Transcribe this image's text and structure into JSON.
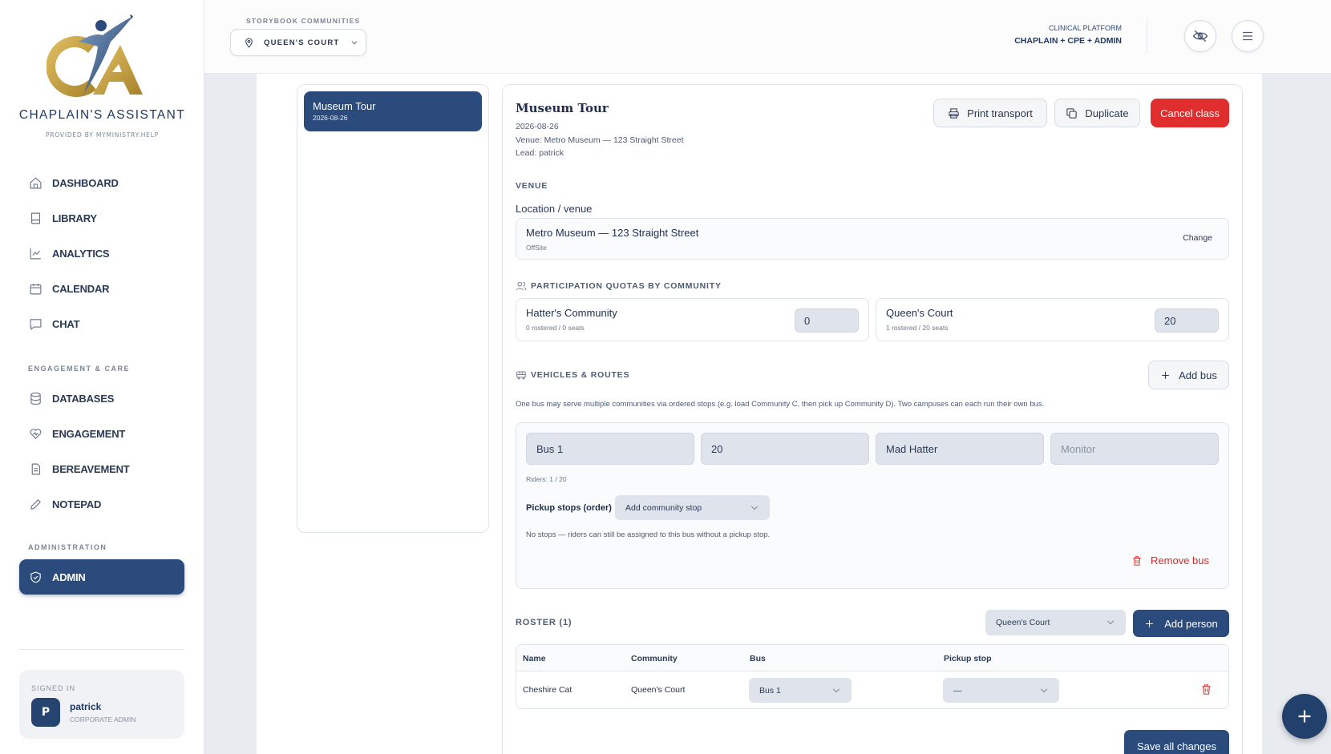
{
  "brand": {
    "name": "CHAPLAIN'S ASSISTANT",
    "sub": "PROVIDED BY MYMINISTRY.HELP",
    "logo_letters": "CA"
  },
  "nav": {
    "main": [
      {
        "label": "DASHBOARD",
        "icon": "home-icon"
      },
      {
        "label": "LIBRARY",
        "icon": "book-icon"
      },
      {
        "label": "ANALYTICS",
        "icon": "chart-icon"
      },
      {
        "label": "CALENDAR",
        "icon": "calendar-icon"
      },
      {
        "label": "CHAT",
        "icon": "chat-icon"
      }
    ],
    "section_engagement": "ENGAGEMENT & CARE",
    "engagement": [
      {
        "label": "DATABASES",
        "icon": "database-icon"
      },
      {
        "label": "ENGAGEMENT",
        "icon": "heart-icon"
      },
      {
        "label": "BEREAVEMENT",
        "icon": "document-icon"
      },
      {
        "label": "NOTEPAD",
        "icon": "pen-icon"
      }
    ],
    "section_admin": "ADMINISTRATION",
    "admin": [
      {
        "label": "ADMIN",
        "icon": "shield-icon",
        "active": true
      }
    ]
  },
  "user": {
    "signed_in_label": "SIGNED IN",
    "initial": "P",
    "name": "patrick",
    "role": "CORPORATE ADMIN"
  },
  "topbar": {
    "community_label": "STORYBOOK COMMUNITIES",
    "community_value": "QUEEN'S COURT",
    "platform_label": "CLINICAL PLATFORM",
    "platform_value": "CHAPLAIN + CPE + ADMIN"
  },
  "class_list": [
    {
      "name": "Museum Tour",
      "date": "2026-08-26",
      "selected": true
    }
  ],
  "detail": {
    "title": "Museum Tour",
    "date": "2026-08-26",
    "venue_line": "Venue: Metro Museum — 123 Straight Street",
    "lead_line": "Lead: patrick",
    "buttons": {
      "print": "Print transport",
      "duplicate": "Duplicate",
      "cancel": "Cancel class"
    },
    "venue_section": "VENUE",
    "location_label": "Location / venue",
    "venue_name": "Metro Museum — 123 Straight Street",
    "venue_type": "OffSite",
    "venue_change": "Change",
    "quotas_section": "PARTICIPATION QUOTAS BY COMMUNITY",
    "quotas": [
      {
        "name": "Hatter's Community",
        "sub": "0 rostered / 0 seats",
        "value": "0"
      },
      {
        "name": "Queen's Court",
        "sub": "1 rostered / 20 seats",
        "value": "20"
      }
    ],
    "vehicles_section": "VEHICLES & ROUTES",
    "add_bus": "Add bus",
    "vehicles_desc": "One bus may serve multiple communities via ordered stops (e.g. load Community C, then pick up Community D). Two campuses can each run their own bus.",
    "bus": {
      "name": "Bus 1",
      "capacity": "20",
      "driver": "Mad Hatter",
      "monitor_placeholder": "Monitor",
      "riders": "Riders: 1 / 20",
      "pickup_label": "Pickup stops (order)",
      "pickup_select": "Add community stop",
      "no_stops": "No stops — riders can still be assigned to this bus without a pickup stop.",
      "remove": "Remove bus"
    },
    "roster_section": "ROSTER (1)",
    "roster_filter": "Queen's Court",
    "add_person": "Add person",
    "roster_columns": [
      "Name",
      "Community",
      "Bus",
      "Pickup stop"
    ],
    "roster_rows": [
      {
        "name": "Cheshire Cat",
        "community": "Queen's Court",
        "bus": "Bus 1",
        "pickup": "—"
      }
    ],
    "save": "Save all changes"
  },
  "colors": {
    "accent": "#2a4b7c",
    "danger": "#e02e2e",
    "logo_gold": "#c9a23a"
  }
}
